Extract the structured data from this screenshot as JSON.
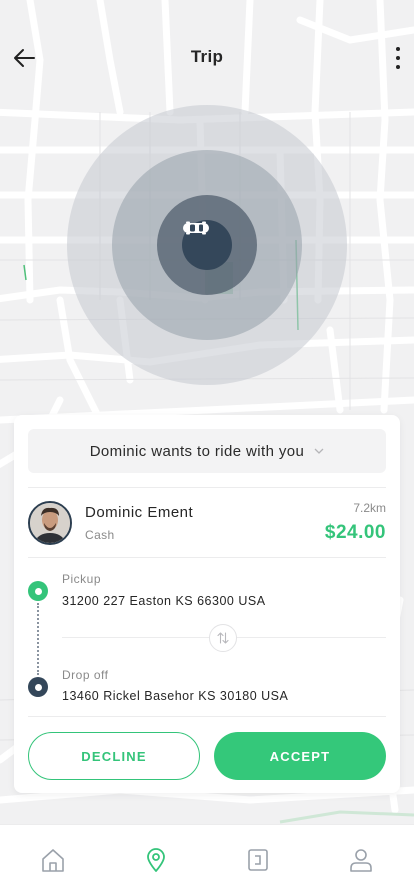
{
  "header": {
    "title": "Trip",
    "back_icon": "arrow-left-icon",
    "more_icon": "more-vertical-icon"
  },
  "map": {
    "vehicle_icon": "car-icon"
  },
  "request": {
    "label": "Dominic wants to ride with you",
    "chevron_icon": "chevron-down-icon"
  },
  "rider": {
    "name": "Dominic Ement",
    "payment": "Cash",
    "distance": "7.2km",
    "fare": "$24.00"
  },
  "route": {
    "pickup_label": "Pickup",
    "pickup_address": "31200 227 Easton KS 66300 USA",
    "dropoff_label": "Drop off",
    "dropoff_address": "13460 Rickel Basehor KS 30180 USA",
    "swap_icon": "swap-vertical-icon"
  },
  "actions": {
    "decline_label": "DECLINE",
    "accept_label": "ACCEPT"
  },
  "tabbar": {
    "items": [
      {
        "icon": "home-icon",
        "active": false
      },
      {
        "icon": "location-pin-icon",
        "active": true
      },
      {
        "icon": "wallet-icon",
        "active": false
      },
      {
        "icon": "profile-icon",
        "active": false
      }
    ]
  },
  "colors": {
    "accent": "#34c47a",
    "dark": "#34475a",
    "map_bg": "#f1f1f2",
    "road": "#ffffff"
  }
}
